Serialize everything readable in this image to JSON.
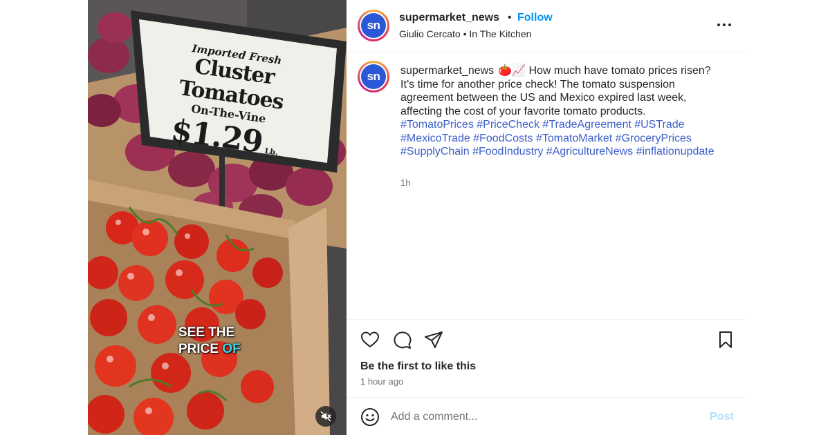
{
  "header": {
    "username": "supermarket_news",
    "separator": "•",
    "follow_label": "Follow",
    "subline": "Giulio Cercato • In The Kitchen",
    "avatar_text": "sn"
  },
  "media": {
    "sign": {
      "line1": "Imported Fresh",
      "line2": "Cluster Tomatoes",
      "line3": "On-The-Vine",
      "price": "$1.29",
      "unit": "Lb."
    },
    "overlay_line1": "SEE THE",
    "overlay_line2a": "PRICE ",
    "overlay_line2b": "OF"
  },
  "post": {
    "username": "supermarket_news",
    "text": "🍅📈 How much have tomato prices risen? It’s time for another price check! The tomato suspension agreement between the US and Mexico expired last week, affecting the cost of your favorite tomato products.",
    "hashtags": "#TomatoPrices #PriceCheck #TradeAgreement #USTrade #MexicoTrade #FoodCosts #TomatoMarket #GroceryPrices #SupplyChain #FoodIndustry #AgricultureNews #inflationupdate",
    "time": "1h"
  },
  "actions": {
    "likes_text": "Be the first to like this",
    "posted_time": "1 hour ago"
  },
  "comment": {
    "placeholder": "Add a comment...",
    "post_label": "Post"
  },
  "icons": {
    "like": "heart-icon",
    "comment": "comment-bubble-icon",
    "share": "paper-plane-icon",
    "save": "bookmark-icon",
    "emoji": "smiley-icon",
    "more": "more-dots-icon",
    "mute": "speaker-muted-icon"
  },
  "colors": {
    "accent": "#0095f6",
    "hashtag": "#3d5fc9",
    "post_disabled": "#b2dffc",
    "brand_avatar": "#2a58d6"
  }
}
